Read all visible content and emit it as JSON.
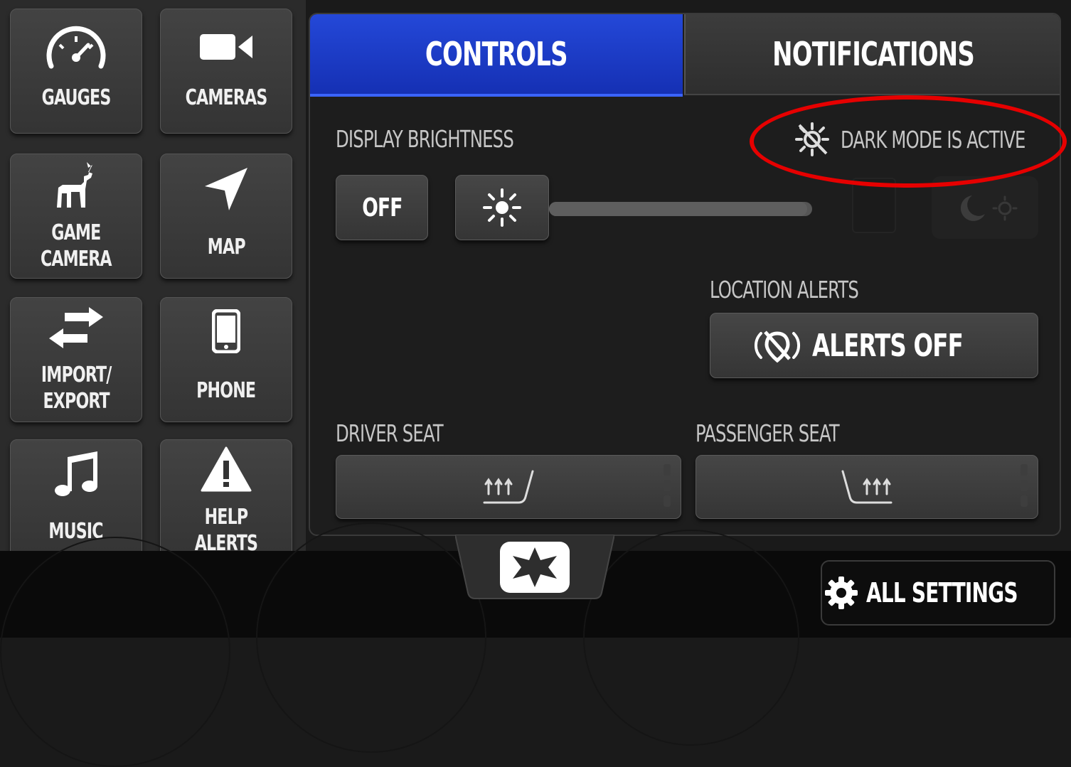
{
  "sidebar": {
    "tiles": [
      {
        "label": "GAUGES",
        "icon": "speedometer-icon"
      },
      {
        "label": "CAMERAS",
        "icon": "video-camera-icon"
      },
      {
        "label": "GAME\nCAMERA",
        "icon": "deer-icon"
      },
      {
        "label": "MAP",
        "icon": "navigation-arrow-icon"
      },
      {
        "label": "IMPORT/\nEXPORT",
        "icon": "swap-arrows-icon"
      },
      {
        "label": "PHONE",
        "icon": "smartphone-icon"
      },
      {
        "label": "MUSIC",
        "icon": "music-note-icon"
      },
      {
        "label": "HELP\nALERTS",
        "icon": "warning-icon"
      }
    ]
  },
  "tabs": {
    "controls": "CONTROLS",
    "notifications": "NOTIFICATIONS",
    "active": "controls"
  },
  "brightness": {
    "label": "DISPLAY BRIGHTNESS",
    "off_label": "OFF",
    "dark_mode_status": "DARK MODE IS ACTIVE",
    "level": 0.98
  },
  "location_alerts": {
    "label": "LOCATION ALERTS",
    "button_label": "ALERTS OFF"
  },
  "seats": {
    "driver_label": "DRIVER SEAT",
    "passenger_label": "PASSENGER SEAT"
  },
  "footer": {
    "all_settings_label": "ALL SETTINGS",
    "home_icon": "polaris-star-icon"
  },
  "colors": {
    "active_tab": "#1e3cc8",
    "highlight": "#e60000",
    "background": "#1d1d1d"
  }
}
